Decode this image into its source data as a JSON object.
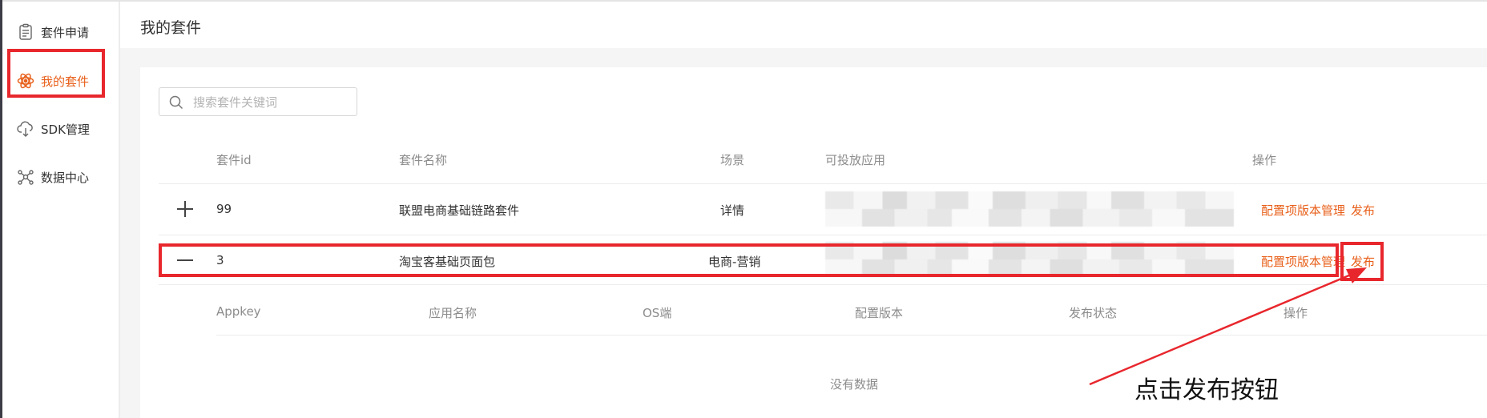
{
  "sidebar": {
    "items": [
      {
        "label": "套件申请",
        "icon": "clipboard-icon"
      },
      {
        "label": "我的套件",
        "icon": "atom-icon",
        "active": true
      },
      {
        "label": "SDK管理",
        "icon": "cloud-download-icon"
      },
      {
        "label": "数据中心",
        "icon": "network-icon"
      }
    ]
  },
  "header": {
    "title": "我的套件"
  },
  "search": {
    "placeholder": "搜索套件关键词",
    "value": ""
  },
  "table": {
    "columns": [
      "套件id",
      "套件名称",
      "场景",
      "可投放应用",
      "操作"
    ],
    "rows": [
      {
        "expand_icon": "plus-icon",
        "id": "99",
        "name": "联盟电商基础链路套件",
        "scene": "详情",
        "apps": "",
        "action_config": "配置项版本管理",
        "action_publish": "发布"
      },
      {
        "expand_icon": "minus-icon",
        "id": "3",
        "name": "淘宝客基础页面包",
        "scene": "电商-营销",
        "apps": "",
        "action_config": "配置项版本管理",
        "action_publish": "发布"
      }
    ]
  },
  "subtable": {
    "columns": [
      "Appkey",
      "应用名称",
      "OS端",
      "配置版本",
      "发布状态",
      "操作"
    ],
    "empty_text": "没有数据"
  },
  "annotation": {
    "text": "点击发布按钮",
    "color": "#e8272d"
  },
  "colors": {
    "accent": "#e8601b",
    "annotation": "#e8272d"
  }
}
